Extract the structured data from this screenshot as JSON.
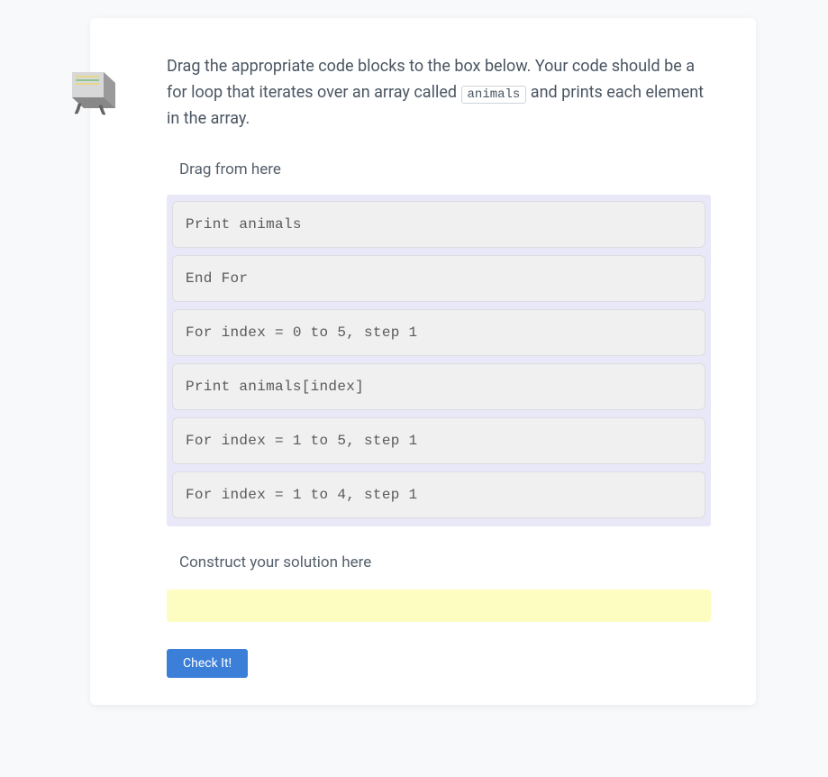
{
  "instructions": {
    "part1": "Drag the appropriate code blocks to the box below. Your code should be a for loop that iterates over an array called ",
    "code": "animals",
    "part2": " and prints each element in the array."
  },
  "labels": {
    "source": "Drag from here",
    "solution": "Construct your solution here"
  },
  "blocks": [
    "Print animals",
    "End For",
    "For index = 0 to 5, step 1",
    "Print animals[index]",
    "For index = 1 to 5, step 1",
    "For index = 1 to 4, step 1"
  ],
  "button": {
    "check": "Check It!"
  }
}
